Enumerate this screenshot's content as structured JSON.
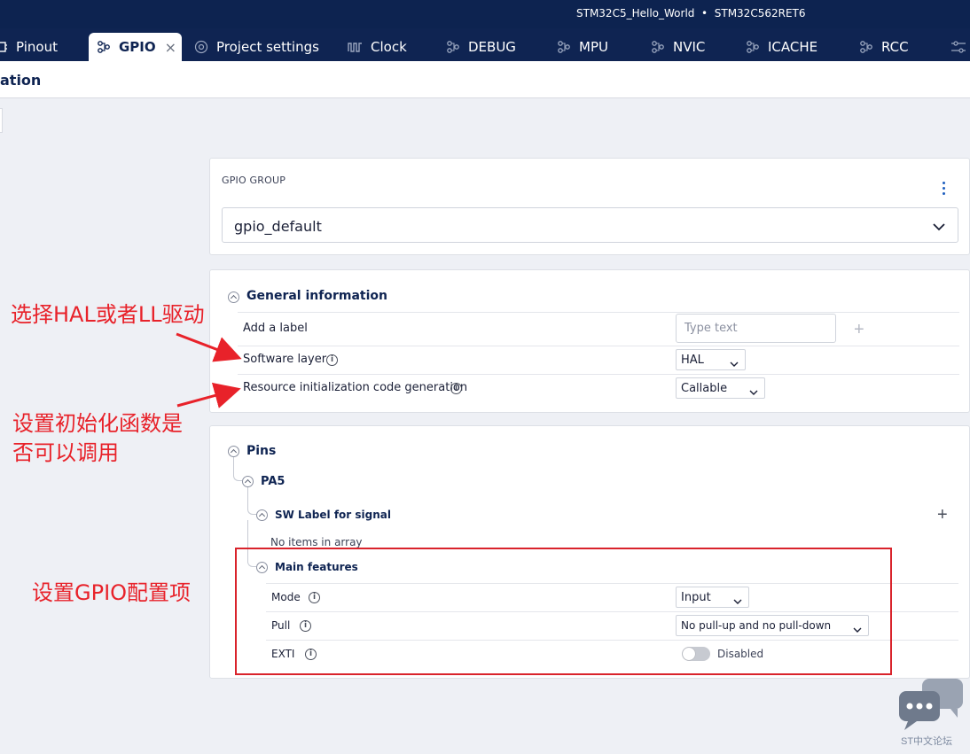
{
  "titlebar": {
    "project": "STM32C5_Hello_World",
    "separator": "•",
    "device": "STM32C562RET6"
  },
  "tabs": [
    {
      "label": "Pinout",
      "icon": "chip-icon"
    },
    {
      "label": "GPIO",
      "icon": "node-icon",
      "active": true,
      "close": "×"
    },
    {
      "label": "Project settings",
      "icon": "settings-circle-icon"
    },
    {
      "label": "Clock",
      "icon": "clock-wave-icon"
    },
    {
      "label": "DEBUG",
      "icon": "node-icon"
    },
    {
      "label": "MPU",
      "icon": "node-icon"
    },
    {
      "label": "NVIC",
      "icon": "node-icon"
    },
    {
      "label": "ICACHE",
      "icon": "node-icon"
    },
    {
      "label": "RCC",
      "icon": "node-icon"
    }
  ],
  "header": {
    "title": "ation"
  },
  "gpio_group": {
    "caption": "GPIO GROUP",
    "selected": "gpio_default"
  },
  "general_info": {
    "title": "General information",
    "add_label": "Add a label",
    "label_placeholder": "Type text",
    "software_layer": {
      "label": "Software layer",
      "value": "HAL"
    },
    "resource_init": {
      "label": "Resource initialization code generation",
      "value": "Callable"
    }
  },
  "pins": {
    "title": "Pins",
    "pin": "PA5",
    "sw_label": "SW Label for signal",
    "empty_array": "No items in array",
    "main_features": "Main features",
    "mode": {
      "label": "Mode",
      "value": "Input"
    },
    "pull": {
      "label": "Pull",
      "value": "No pull-up and no pull-down"
    },
    "exti": {
      "label": "EXTI",
      "value": "Disabled",
      "enabled": false
    }
  },
  "annotations": {
    "driver": "选择HAL或者LL驱动",
    "init_line1": "设置初始化函数是",
    "init_line2": "否可以调用",
    "gpio_cfg": "设置GPIO配置项",
    "color": "#e8222a"
  },
  "watermark": {
    "text": "ST中文论坛"
  },
  "colors": {
    "navy": "#0f2452",
    "accent": "#1f5fbf",
    "background": "#eef0f5"
  }
}
